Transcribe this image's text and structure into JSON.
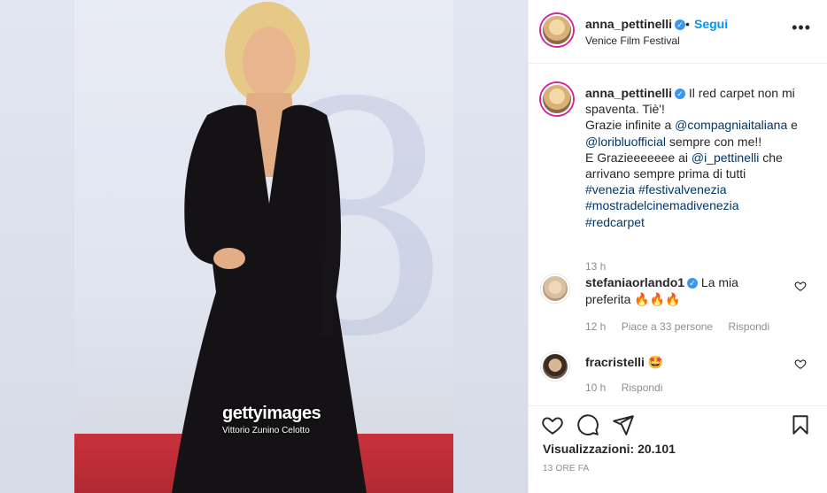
{
  "post": {
    "watermark": {
      "brand": "gettyimages",
      "credit": "Vittorio Zunino Celotto"
    }
  },
  "header": {
    "username": "anna_pettinelli",
    "verified_mark": "✓",
    "dot": "•",
    "follow_label": "Segui",
    "location": "Venice Film Festival",
    "more": "•••"
  },
  "caption": {
    "username": "anna_pettinelli",
    "line1": "Il red carpet non mi spaventa. Tiè'!",
    "line2_prefix": "Grazie infinite a ",
    "mention1": "@compagniaitaliana",
    "line2_mid": " e",
    "mention2": "@loribluofficial",
    "line3_suffix": " sempre con me!!",
    "line4_prefix": "E Grazieeeeeee ai ",
    "mention3": "@i_pettinelli",
    "line4_suffix": " che arrivano sempre prima di tutti",
    "hashtags": [
      "#venezia",
      "#festivalvenezia",
      "#mostradelcinemadivenezia",
      "#redcarpet"
    ],
    "time": "13 h"
  },
  "comments": [
    {
      "username": "stefaniaorlando1",
      "verified": true,
      "text": "La mia preferita 🔥🔥🔥",
      "time": "12 h",
      "likes": "Piace a 33 persone",
      "reply": "Rispondi"
    },
    {
      "username": "fracristelli",
      "verified": false,
      "text": "🤩",
      "time": "10 h",
      "reply": "Rispondi"
    }
  ],
  "actions": {
    "views_label": "Visualizzazioni: 20.101",
    "age": "13 ORE FA"
  },
  "icons": [
    "heart-icon",
    "comment-icon",
    "share-icon",
    "bookmark-icon",
    "more-icon",
    "verified-icon"
  ],
  "colors": {
    "accent": "#0095f6",
    "link": "#00376b",
    "muted": "#8e8e8e",
    "verified": "#3897f0"
  }
}
